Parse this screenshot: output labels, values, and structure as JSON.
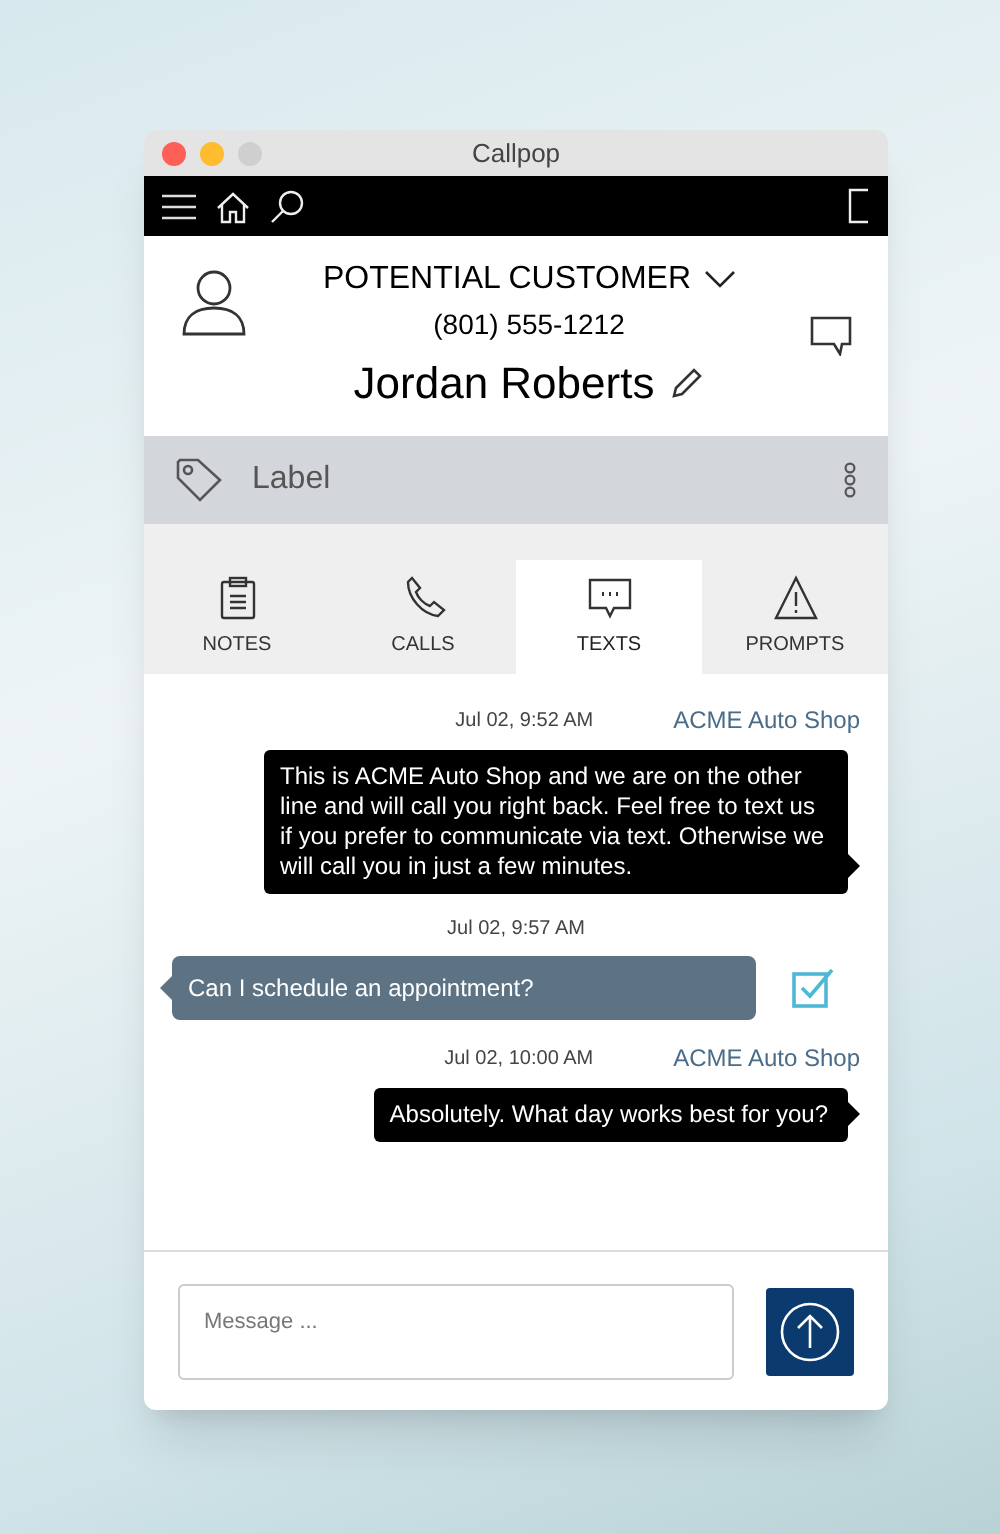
{
  "window": {
    "title": "Callpop"
  },
  "contact": {
    "status": "POTENTIAL CUSTOMER",
    "phone": "(801) 555-1212",
    "name": "Jordan Roberts"
  },
  "label_bar": {
    "label": "Label"
  },
  "tabs": [
    {
      "label": "NOTES",
      "selected": false
    },
    {
      "label": "CALLS",
      "selected": false
    },
    {
      "label": "TEXTS",
      "selected": true
    },
    {
      "label": "PROMPTS",
      "selected": false
    }
  ],
  "messages": [
    {
      "kind": "outgoing",
      "time": "Jul 02, 9:52 AM",
      "sender": "ACME Auto Shop",
      "text": "This is ACME Auto Shop and we are on the other line and will call you right back. Feel free to text us if you prefer to communicate via text. Otherwise we will call you in just a few minutes."
    },
    {
      "kind": "incoming",
      "time": "Jul 02, 9:57 AM",
      "text": "Can I schedule an appointment?",
      "checked": true
    },
    {
      "kind": "outgoing",
      "time": "Jul 02, 10:00 AM",
      "sender": "ACME Auto Shop",
      "text": "Absolutely. What day works best for you?"
    }
  ],
  "composer": {
    "placeholder": "Message ..."
  }
}
